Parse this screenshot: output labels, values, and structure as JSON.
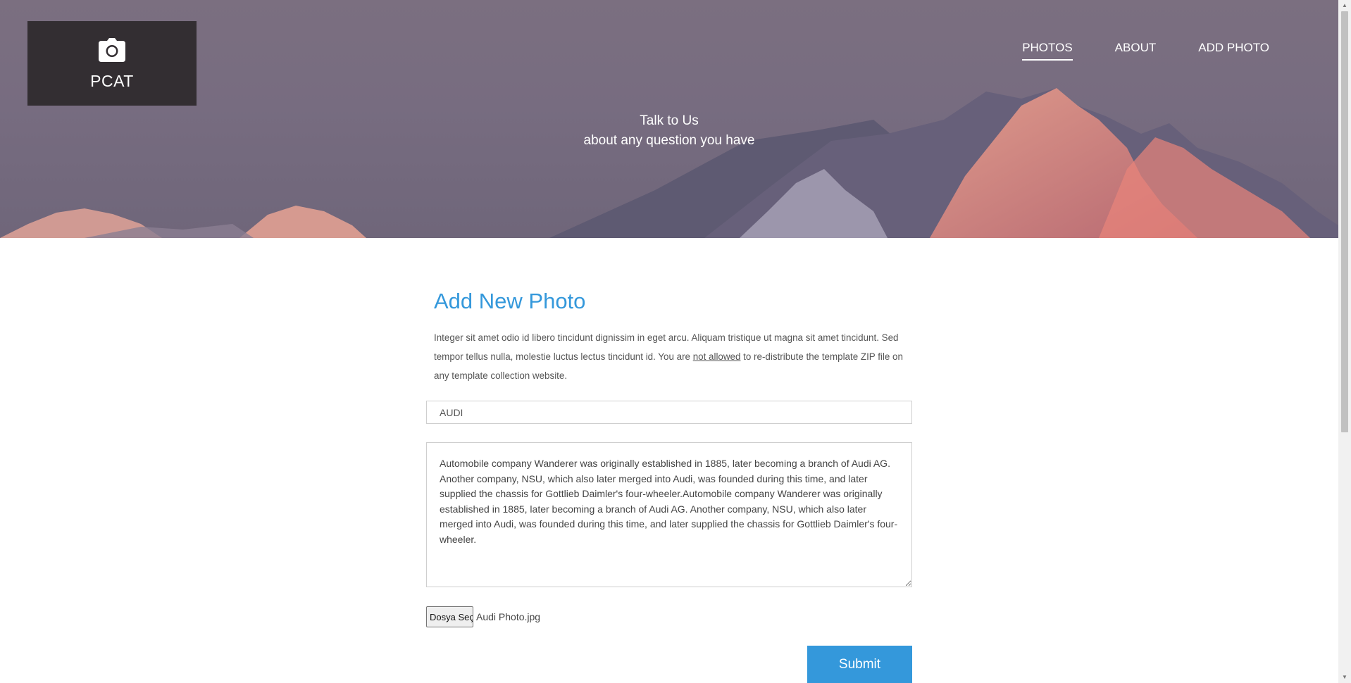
{
  "brand": {
    "name": "PCAT",
    "icon": "camera-icon"
  },
  "nav": {
    "items": [
      {
        "label": "PHOTOS",
        "active": true
      },
      {
        "label": "ABOUT",
        "active": false
      },
      {
        "label": "ADD PHOTO",
        "active": false
      }
    ]
  },
  "hero": {
    "line1": "Talk to Us",
    "line2": "about any question you have"
  },
  "form": {
    "title": "Add New Photo",
    "intro_before": "Integer sit amet odio id libero tincidunt dignissim in eget arcu. Aliquam tristique ut magna sit amet tincidunt. Sed tempor tellus nulla, molestie luctus lectus tincidunt id. You are ",
    "intro_link": "not allowed",
    "intro_after": " to re-distribute the template ZIP file on any template collection website.",
    "title_value": "AUDI",
    "description_value": "Automobile company Wanderer was originally established in 1885, later becoming a branch of Audi AG. Another company, NSU, which also later merged into Audi, was founded during this time, and later supplied the chassis for Gottlieb Daimler's four-wheeler.Automobile company Wanderer was originally established in 1885, later becoming a branch of Audi AG. Another company, NSU, which also later merged into Audi, was founded during this time, and later supplied the chassis for Gottlieb Daimler's four-wheeler.",
    "file_button_label": "Dosya Seç",
    "file_name": "Audi Photo.jpg",
    "submit_label": "Submit"
  },
  "colors": {
    "accent": "#3498db",
    "logo_bg": "#332e32",
    "hero_sky": "#776c80",
    "peak_glow": "#ef8f7c"
  }
}
